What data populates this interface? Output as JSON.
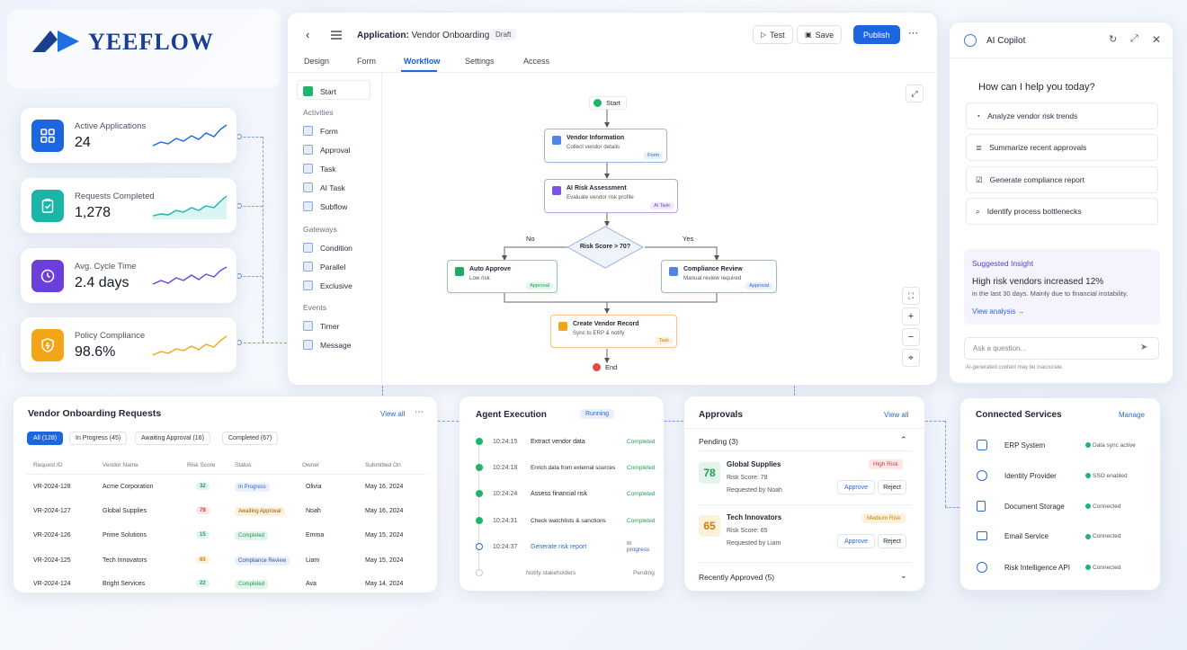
{
  "brand": {
    "name": "YEEFLOW"
  },
  "kpis": [
    {
      "label": "Active Applications",
      "value": "24",
      "icon": "grid-icon",
      "color": "#1c66e0"
    },
    {
      "label": "Requests Completed",
      "value": "1,278",
      "icon": "clipboard-check-icon",
      "color": "#1bb5a8"
    },
    {
      "label": "Avg. Cycle Time",
      "value": "2.4 days",
      "icon": "clock-icon",
      "color": "#6b3fd9"
    },
    {
      "label": "Policy Compliance",
      "value": "98.6%",
      "icon": "shield-icon",
      "color": "#f2a516"
    }
  ],
  "editor": {
    "title_prefix": "Application:",
    "title": "Vendor Onboarding",
    "status": "Draft",
    "test_label": "Test",
    "save_label": "Save",
    "publish_label": "Publish",
    "tabs": [
      "Design",
      "Form",
      "Workflow",
      "Settings",
      "Access"
    ],
    "active_tab": "Workflow",
    "palette": {
      "start": "Start",
      "activities_title": "Activities",
      "activities": [
        "Form",
        "Approval",
        "Task",
        "AI Task",
        "Subflow"
      ],
      "gateways_title": "Gateways",
      "gateways": [
        "Condition",
        "Parallel",
        "Exclusive"
      ],
      "events_title": "Events",
      "events": [
        "Timer",
        "Message"
      ]
    },
    "flow": {
      "start": "Start",
      "end": "End",
      "vendor_info": {
        "title": "Vendor Information",
        "sub": "Collect vendor details",
        "badge": "Form"
      },
      "ai_risk": {
        "title": "AI Risk Assessment",
        "sub": "Evaluate vendor risk profile",
        "badge": "AI Task"
      },
      "decision": "Risk Score > 70?",
      "no_label": "No",
      "yes_label": "Yes",
      "auto_approve": {
        "title": "Auto Approve",
        "sub": "Low risk",
        "badge": "Approval"
      },
      "compliance": {
        "title": "Compliance Review",
        "sub": "Manual review required",
        "badge": "Approval"
      },
      "create_record": {
        "title": "Create Vendor Record",
        "sub": "Sync to ERP & notify",
        "badge": "Task"
      }
    }
  },
  "copilot": {
    "title": "AI Copilot",
    "greeting": "How can I help you today?",
    "suggestions": [
      "Analyze vendor risk trends",
      "Summarize recent approvals",
      "Generate compliance report",
      "Identify process bottlenecks"
    ],
    "insight_label": "Suggested Insight",
    "insight_title": "High risk vendors increased 12%",
    "insight_text": "in the last 30 days. Mainly due to financial instability.",
    "insight_link": "View analysis →",
    "input_placeholder": "Ask a question...",
    "disclaimer": "AI-generated content may be inaccurate."
  },
  "requests": {
    "title": "Vendor Onboarding Requests",
    "view_all": "View all",
    "filters": [
      "All (128)",
      "In Progress (45)",
      "Awaiting Approval (16)",
      "Completed (67)"
    ],
    "columns": [
      "Request ID",
      "Vendor Name",
      "Risk Score",
      "Status",
      "Owner",
      "Submitted On"
    ],
    "rows": [
      {
        "id": "VR-2024-128",
        "vendor": "Acme Corporation",
        "risk": "32",
        "status": "In Progress",
        "owner": "Olivia",
        "date": "May 16, 2024"
      },
      {
        "id": "VR-2024-127",
        "vendor": "Global Supplies",
        "risk": "78",
        "status": "Awaiting Approval",
        "owner": "Noah",
        "date": "May 16, 2024"
      },
      {
        "id": "VR-2024-126",
        "vendor": "Prime Solutions",
        "risk": "15",
        "status": "Completed",
        "owner": "Emma",
        "date": "May 15, 2024"
      },
      {
        "id": "VR-2024-125",
        "vendor": "Tech Innovators",
        "risk": "65",
        "status": "Compliance Review",
        "owner": "Liam",
        "date": "May 15, 2024"
      },
      {
        "id": "VR-2024-124",
        "vendor": "Bright Services",
        "risk": "22",
        "status": "Completed",
        "owner": "Ava",
        "date": "May 14, 2024"
      }
    ]
  },
  "agent": {
    "title": "Agent Execution",
    "status": "Running",
    "steps": [
      {
        "time": "10:24:15",
        "task": "Extract vendor data",
        "state": "Completed"
      },
      {
        "time": "10:24:18",
        "task": "Enrich data from external sources",
        "state": "Completed"
      },
      {
        "time": "10:24:24",
        "task": "Assess financial risk",
        "state": "Completed"
      },
      {
        "time": "10:24:31",
        "task": "Check watchlists & sanctions",
        "state": "Completed"
      },
      {
        "time": "10:24:37",
        "task": "Generate risk report",
        "state": "In progress"
      },
      {
        "time": "",
        "task": "Notify stakeholders",
        "state": "Pending"
      }
    ]
  },
  "approvals": {
    "title": "Approvals",
    "view_all": "View all",
    "pending_label": "Pending (3)",
    "items": [
      {
        "score": "78",
        "name": "Global Supplies",
        "risk_line": "Risk Score: 78",
        "requested": "Requested by Noah",
        "tag": "High Risk"
      },
      {
        "score": "65",
        "name": "Tech Innovators",
        "risk_line": "Risk Score: 65",
        "requested": "Requested by Liam",
        "tag": "Medium Risk"
      }
    ],
    "approve_label": "Approve",
    "reject_label": "Reject",
    "recent_label": "Recently Approved (5)"
  },
  "services": {
    "title": "Connected Services",
    "manage": "Manage",
    "items": [
      {
        "name": "ERP System",
        "status": "Data sync active",
        "icon": "erp-icon"
      },
      {
        "name": "Identity Provider",
        "status": "SSO enabled",
        "icon": "fingerprint-icon"
      },
      {
        "name": "Document Storage",
        "status": "Connected",
        "icon": "document-icon"
      },
      {
        "name": "Email Service",
        "status": "Connected",
        "icon": "mail-icon"
      },
      {
        "name": "Risk Intelligence API",
        "status": "Connected",
        "icon": "globe-icon"
      }
    ]
  }
}
